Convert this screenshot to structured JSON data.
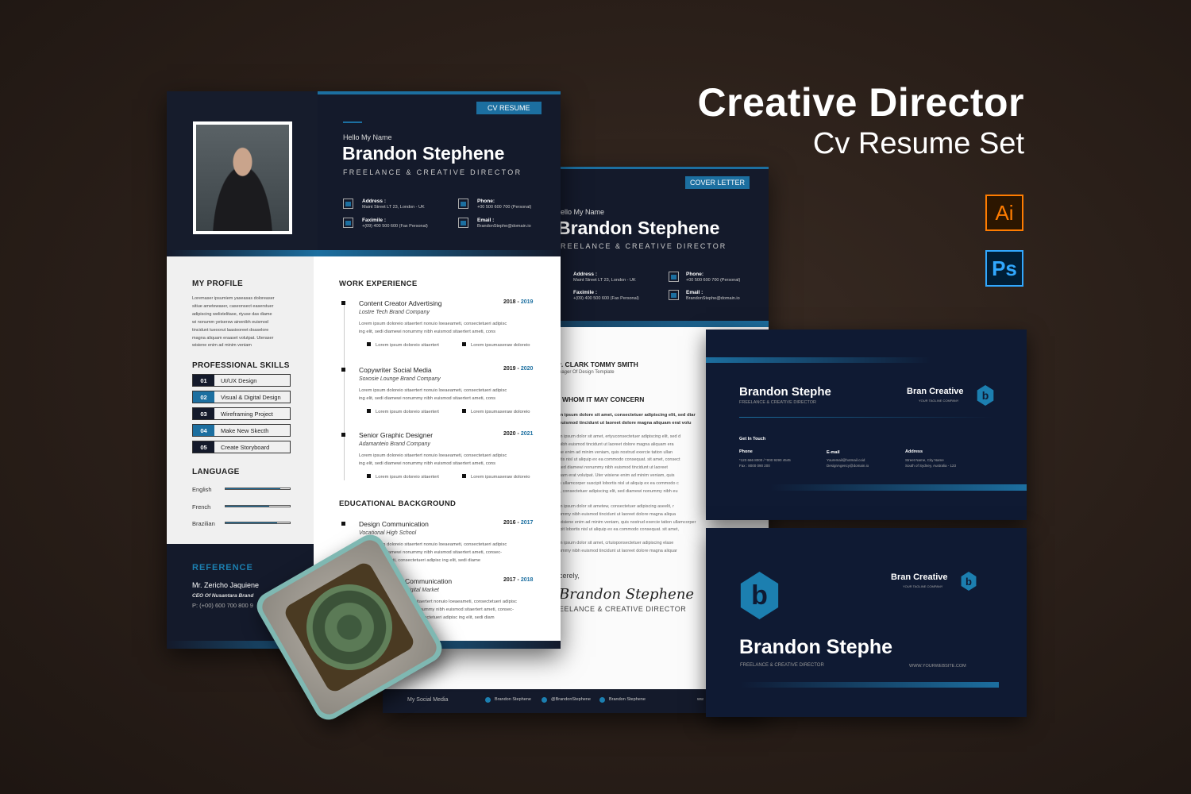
{
  "hero": {
    "title": "Creative Director",
    "subtitle": "Cv Resume Set",
    "app_badges": [
      {
        "label": "Ai",
        "color": "#ff7c00"
      },
      {
        "label": "Ps",
        "color": "#31a8ff"
      }
    ]
  },
  "colors": {
    "navy": "#141a2b",
    "accent": "#1c6fa0",
    "card": "#0f1a33"
  },
  "resume": {
    "tag": "CV RESUME",
    "greeting": "Hello My Name",
    "name": "Brandon Stephene",
    "role": "FREELANCE & CREATIVE DIRECTOR",
    "contact": [
      {
        "label": "Address :",
        "value": "Maint Street LT 23, London - UK",
        "icon": "home-icon"
      },
      {
        "label": "Phone:",
        "value": "+00 500 600 700 (Personal)",
        "icon": "phone-icon"
      },
      {
        "label": "Faximile :",
        "value": "+(09) 400 500 600 (Fax Personal)",
        "icon": "fax-icon"
      },
      {
        "label": "Email :",
        "value": "BrandonStephe@domain.io",
        "icon": "mail-icon"
      }
    ],
    "profile": {
      "heading": "MY PROFILE",
      "lines": [
        "Loremaser ipsumiem yaseasas doloreaser",
        "sitiue ametewaser, caseonsect easerstuer",
        "adipiscing welistelitase, rtyuse das diame",
        "wi nonumm yetsersw ainenibh euismod",
        "tincidunt tueoorut laasiooreet doaselore",
        "magna aliquam eraaset volutpat. Uteraser",
        "wisiene enim ad minim veniam"
      ]
    },
    "skills": {
      "heading": "PROFESSIONAL SKILLS",
      "items": [
        {
          "num": "01",
          "label": "UI/UX Design"
        },
        {
          "num": "02",
          "label": "Visual & Digital Design"
        },
        {
          "num": "03",
          "label": "Wireframing Project"
        },
        {
          "num": "04",
          "label": "Make New Skecth"
        },
        {
          "num": "05",
          "label": "Create Storyboard"
        }
      ]
    },
    "language": {
      "heading": "LANGUAGE",
      "items": [
        {
          "label": "English",
          "level": 0.85
        },
        {
          "label": "French",
          "level": 0.68
        },
        {
          "label": "Brazilian",
          "level": 0.8
        }
      ]
    },
    "reference": {
      "heading": "REFERENCE",
      "name": "Mr. Zericho Jaquiene",
      "title": "CEO Of Nusantara Brand",
      "phone": "P: (+00) 600 700 800 9"
    },
    "work": {
      "heading": "WORK EXPERIENCE",
      "items": [
        {
          "title": "Content Creator Advertising",
          "company": "Lostre Tech Brand Company",
          "from": "2018",
          "to": "2019",
          "line1": "Lorem ipsum doloreio sitaertert nonuio loeaeameti, consectetueri adipisc",
          "line2": "ing elit, sedi diamewi nonummy nibh euismod  sitaertert ameti, cons",
          "b1": "Lorem ipsum doloreio sitaertert",
          "b2": "Lorem ipsumaseraw doloreio"
        },
        {
          "title": "Copywriter Social Media",
          "company": "Soxosie Lounge Brand Company",
          "from": "2019",
          "to": "2020",
          "line1": "Lorem ipsum doloreio sitaertert nonuio loeaeameti, consectetueri adipisc",
          "line2": "ing elit, sedi diamewi nonummy nibh euismod  sitaertert ameti, cons",
          "b1": "Lorem ipsum doloreio sitaertert",
          "b2": "Lorem ipsumaseraw doloreio"
        },
        {
          "title": "Senior Graphic Designer",
          "company": "Adamanteio Brand Company",
          "from": "2020",
          "to": "2021",
          "line1": "Lorem ipsum doloreio sitaertert nonuio loeaeameti, consectetueri adipisc",
          "line2": "ing elit, sedi diamewi nonummy nibh euismod  sitaertert ameti, cons",
          "b1": "Lorem ipsum doloreio sitaertert",
          "b2": "Lorem ipsumaseraw doloreio"
        }
      ]
    },
    "education": {
      "heading": "EDUCATIONAL BACKGROUND",
      "items": [
        {
          "title": "Design Communication",
          "school": "Vocational High School",
          "from": "2016",
          "to": "2017",
          "lines": [
            "Lorem ipsum doloreio sitaertert nonuio loeaeameti, consectetueri adipisc",
            "ing elit, sedi diamewi nonummy nibh euismod  sitaertert ameti, consec-",
            "tetueri loeaeameti, consectetueri adipisc ing elit, sedi diame"
          ]
        },
        {
          "title": "Communication",
          "school": "Digital Market",
          "from": "2017",
          "to": "2018",
          "lines": [
            "sitaertert nonuio loeaeameti, consectetueri adipisc",
            "nonummy nibh euismod  sitaertert ameti, consec-",
            "consectetueri adipisc ing elit, sedi diam"
          ]
        }
      ]
    }
  },
  "letter": {
    "tag": "COVER LETTER",
    "greeting": "ello My Name",
    "name": "Brandon Stephene",
    "role": "REELANCE & CREATIVE DIRECTOR",
    "contact": [
      {
        "label": "Address :",
        "value": "Maint Street LT 23, London - UK"
      },
      {
        "label": "Phone:",
        "value": "+00 500 600 700 (Personal)"
      },
      {
        "label": "Faximile :",
        "value": "+(09) 400 500 600 (Fax Personal)"
      },
      {
        "label": "Email :",
        "value": "BrandonStephe@domain.io"
      }
    ],
    "recipient": "r. CLARK TOMMY SMITH",
    "recipient_title": "nager Of Design Template",
    "salutation": "WHOM IT MAY CONCERN",
    "intro": [
      "m ipsum dolore sit amet, consectetuer adipiscing elit, sed diar",
      "euismod tincidunt ut laoreet dolore magna aliquam erat volu"
    ],
    "para1": [
      "m ipsum dolor sit amet, ertyuconsectetuer adipiscing elit, sed d",
      "nibh euismod tincidunt ut laoreet dolore magna aliquam era",
      "ne enim ad minim veniam, quis nostrud exercie tation ullan",
      "rtis nisl ut aliquip ex ea commodo consequat. sit amet, consect",
      "sed diamewi nonummy nibh euismod tincidunt ut laoreet",
      "uam erat volutpat. Uter wisiene enim ad minim veniam, quis",
      "n ullamcorper suscipit lobortis nisl ut aliquip ex ea commodo c",
      "t, consectetuer adipiscing elit, sed diamewi nonummy nibh eu"
    ],
    "para2": [
      "m ipsum dolor sit ametew, consectetuer adipiscing aseelit, r",
      "ummy nibh euismod tincidunt ut laoreet dolore magna aliqua",
      "wisiene enim ad minim veniam, quis nostrud exercie tation ullamcorper",
      "ipit lobortis nisl ut aliquip ex ea commodo consequat. sit amet,"
    ],
    "para3": [
      "m ipsum dolor sit amet, crtuioponsectetuer adipiscing elase",
      "ummy nibh euismod tincidunt ut laoreet dolore magna aliquar"
    ],
    "closing": "cerely,",
    "signature": "Brandon Stephene",
    "sign_role": "EELANCE & CREATIVE DIRECTOR",
    "footer": {
      "label": "My Social Media",
      "facebook": "Brandon Stephene",
      "twitter": "@BrandonStephene",
      "other": "Brandon Stephene",
      "website": "ww"
    }
  },
  "card_back": {
    "name": "Brandon Stephe",
    "role": "FREELANCE & CREATIVE DIRECTOR",
    "brand": "Bran Creative",
    "tagline": "YOUR TAGLINE COMPANY",
    "logo_letter": "b",
    "touch": "Get In Touch",
    "phone_label": "Phone",
    "phone1": "*123 666 8000 / *000 9290 4545",
    "phone2": "Fax : 8000 090 200",
    "email_label": "E-mail",
    "email1": "Youremail@hotmail.coid",
    "email2": "DesignAgency@domain.io",
    "address_label": "Address",
    "address1": "Street Name, City Name",
    "address2": "South of Sydney, Australia - 123"
  },
  "card_front": {
    "name": "Brandon Stephe",
    "role": "FREELANCE & CREATIVE DIRECTOR",
    "brand": "Bran Creative",
    "tagline": "YOUR TAGLINE COMPANY",
    "logo_letter": "b",
    "website": "WWW.YOURWEBSITE.COM"
  }
}
